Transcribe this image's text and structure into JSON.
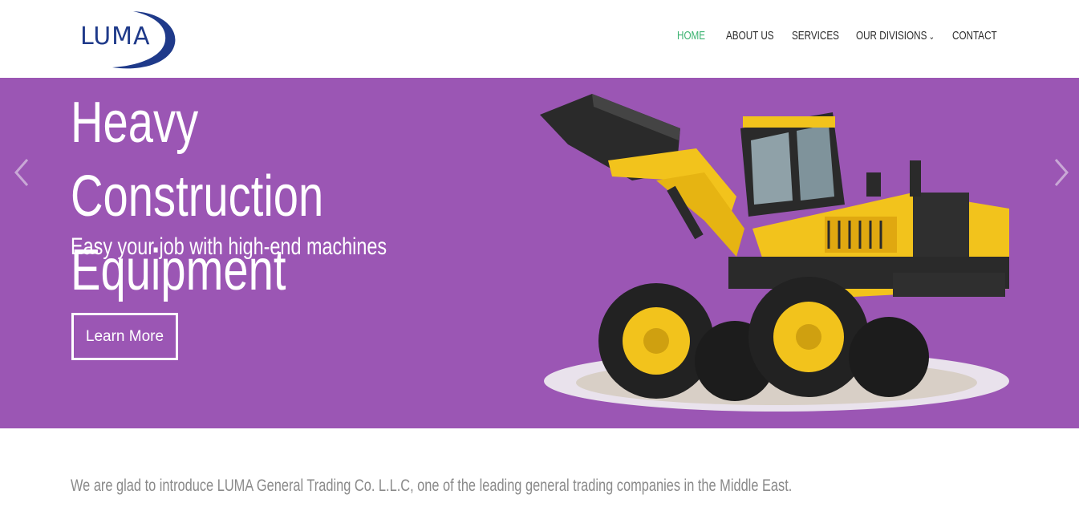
{
  "brand": {
    "logo_text": "LUMA",
    "color": "#1f3a8a"
  },
  "nav": {
    "items": [
      {
        "label": "HOME",
        "active": true
      },
      {
        "label": "ABOUT US"
      },
      {
        "label": "SERVICES"
      },
      {
        "label": "OUR DIVISIONS",
        "has_dropdown": true
      },
      {
        "label": "CONTACT"
      }
    ],
    "active_color": "#3cb371"
  },
  "hero": {
    "title": "Heavy Construction Equipment",
    "subtitle": "Easy your job with high-end machines",
    "button_label": "Learn More",
    "background": "#9b56b4",
    "prev_icon": "chevron-left-icon",
    "next_icon": "chevron-right-icon"
  },
  "intro": {
    "text": "We are glad to introduce LUMA General Trading Co. L.L.C, one of the leading general trading companies in the Middle East."
  }
}
